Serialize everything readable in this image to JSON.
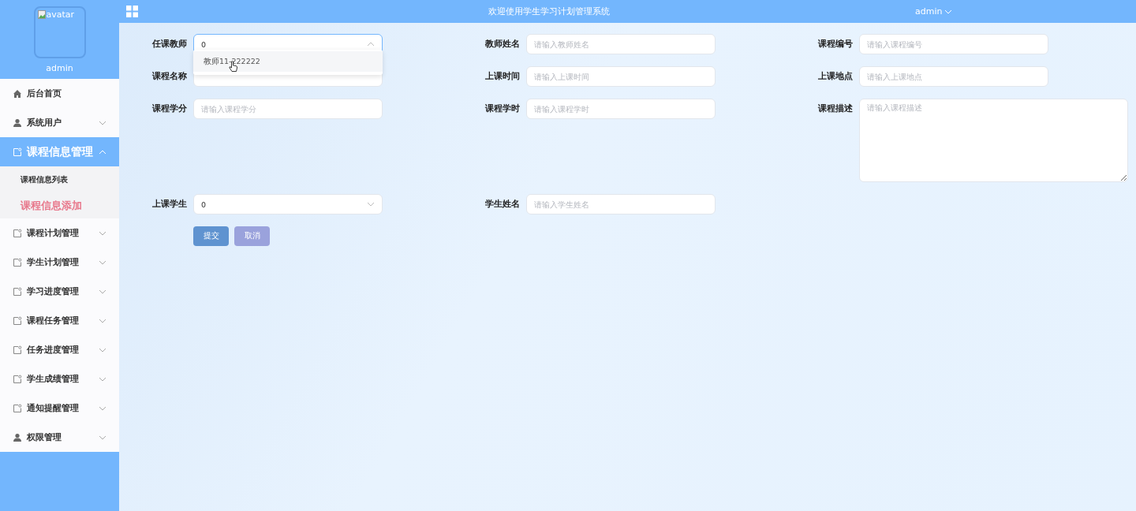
{
  "sidebar": {
    "avatar_alt": "avatar",
    "username": "admin",
    "items": [
      {
        "label": "后台首页",
        "kind": "home"
      },
      {
        "label": "系统用户",
        "kind": "user",
        "expanded": false
      },
      {
        "label": "课程信息管理",
        "kind": "module",
        "expanded": true,
        "children": [
          {
            "label": "课程信息列表",
            "selected": false
          },
          {
            "label": "课程信息添加",
            "selected": true
          }
        ]
      },
      {
        "label": "课程计划管理",
        "kind": "module",
        "expanded": false
      },
      {
        "label": "学生计划管理",
        "kind": "module",
        "expanded": false
      },
      {
        "label": "学习进度管理",
        "kind": "module",
        "expanded": false
      },
      {
        "label": "课程任务管理",
        "kind": "module",
        "expanded": false
      },
      {
        "label": "任务进度管理",
        "kind": "module",
        "expanded": false
      },
      {
        "label": "学生成绩管理",
        "kind": "module",
        "expanded": false
      },
      {
        "label": "通知提醒管理",
        "kind": "module",
        "expanded": false
      },
      {
        "label": "权限管理",
        "kind": "user",
        "expanded": false
      }
    ]
  },
  "header": {
    "title": "欢迎使用学生学习计划管理系统",
    "user": "admin"
  },
  "form": {
    "fields": [
      {
        "label": "任课教师",
        "kind": "select",
        "value": "0",
        "expanded": true,
        "options": [
          {
            "label": "教师11-222222",
            "selected": false
          }
        ]
      },
      {
        "label": "教师姓名",
        "kind": "input",
        "placeholder": "请输入教师姓名"
      },
      {
        "label": "课程编号",
        "kind": "input",
        "placeholder": "请输入课程编号"
      },
      {
        "label": "课程名称",
        "kind": "input"
      },
      {
        "label": "上课时间",
        "kind": "input",
        "placeholder": "请输入上课时间"
      },
      {
        "label": "上课地点",
        "kind": "input",
        "placeholder": "请输入上课地点"
      },
      {
        "label": "课程学分",
        "kind": "input",
        "placeholder": "请输入课程学分"
      },
      {
        "label": "课程学时",
        "kind": "input",
        "placeholder": "请输入课程学时"
      },
      {
        "label": "课程描述",
        "kind": "textarea",
        "placeholder": "请输入课程描述"
      },
      {
        "label": "上课学生",
        "kind": "select",
        "value": "0",
        "expanded": false
      },
      {
        "label": "学生姓名",
        "kind": "input",
        "placeholder": "请输入学生姓名"
      }
    ],
    "buttons": [
      {
        "label": "提交",
        "kind": "primary"
      },
      {
        "label": "取消",
        "kind": "secondary"
      }
    ]
  }
}
